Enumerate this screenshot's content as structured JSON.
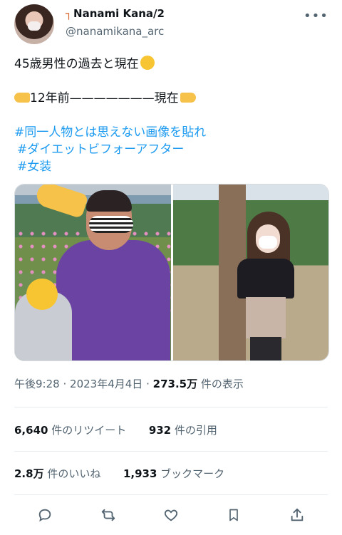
{
  "author": {
    "name": "Nanami Kana/2",
    "name_prefix_glyph": "┐",
    "handle": "@nanamikana_arc"
  },
  "more_icon": "more-icon",
  "tweet": {
    "line1": "45歳男性の過去と現在",
    "line2_left": "12年前",
    "line2_dash": "———————",
    "line2_right": "現在",
    "hashtags": [
      "#同一人物とは思えない画像を貼れ",
      "#ダイエットビフォーアフター",
      "#女装"
    ]
  },
  "meta": {
    "time": "午後9:28",
    "sep": "·",
    "date": "2023年4月4日",
    "views_value": "273.5万",
    "views_label": "件の表示"
  },
  "stats": {
    "retweets_value": "6,640",
    "retweets_label": "件のリツイート",
    "quotes_value": "932",
    "quotes_label": "件の引用",
    "likes_value": "2.8万",
    "likes_label": "件のいいね",
    "bookmarks_value": "1,933",
    "bookmarks_label": "ブックマーク"
  },
  "actions": [
    "reply-icon",
    "retweet-icon",
    "like-icon",
    "bookmark-icon",
    "share-icon"
  ],
  "colors": {
    "link": "#1d9bf0",
    "secondary": "#536471",
    "text": "#0f1419"
  }
}
